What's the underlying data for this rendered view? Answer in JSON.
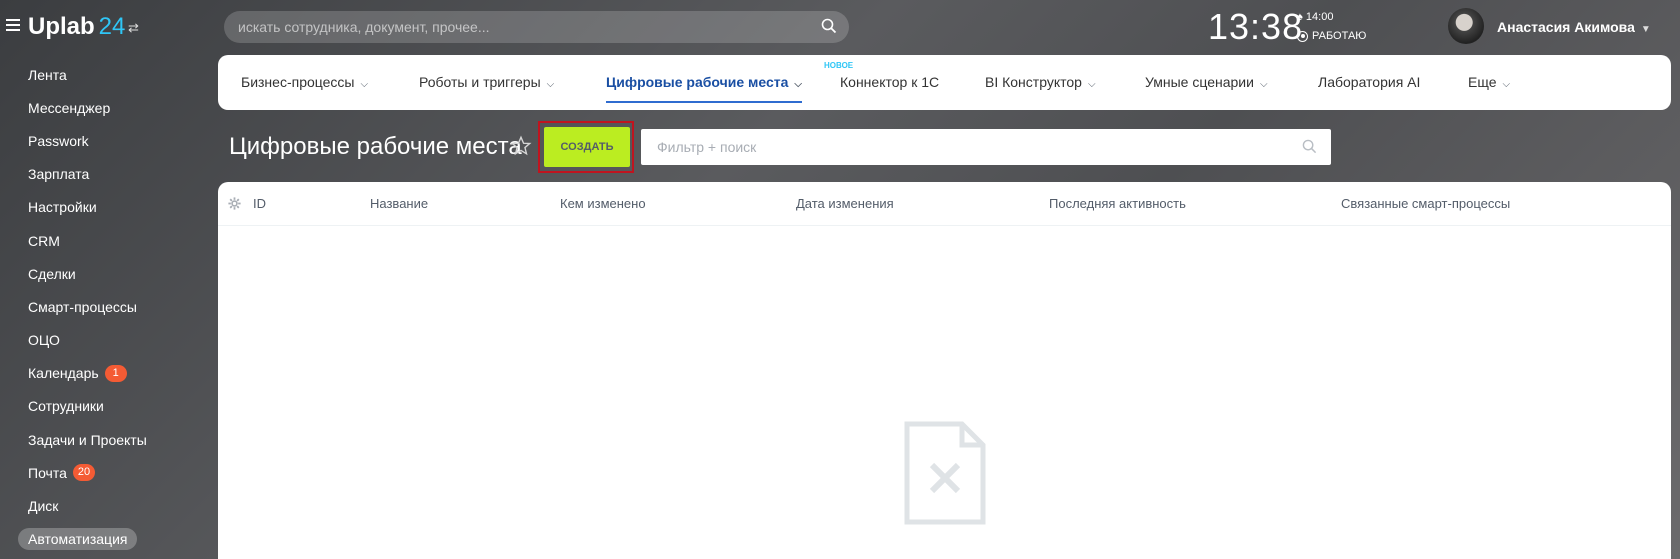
{
  "header": {
    "logo_text": "Uplab",
    "logo_num": "24",
    "search_placeholder": "искать сотрудника, документ, прочее...",
    "clock": "13:38",
    "alarm_time": "14:00",
    "work_status": "РАБОТАЮ",
    "user_name": "Анастасия Акимова",
    "accent_color": "#2fc6f6"
  },
  "sidebar": {
    "items": [
      {
        "label": "Лента"
      },
      {
        "label": "Мессенджер"
      },
      {
        "label": "Passwork"
      },
      {
        "label": "Зарплата"
      },
      {
        "label": "Настройки"
      },
      {
        "label": "CRM"
      },
      {
        "label": "Сделки"
      },
      {
        "label": "Смарт-процессы"
      },
      {
        "label": "ОЦО"
      },
      {
        "label": "Календарь",
        "badge": "1"
      },
      {
        "label": "Сотрудники"
      },
      {
        "label": "Задачи и Проекты"
      },
      {
        "label": "Почта",
        "badge": "20"
      },
      {
        "label": "Диск"
      },
      {
        "label": "Автоматизация",
        "active": true
      }
    ],
    "badge_color": "#f45b34"
  },
  "nav": {
    "new_tag": "НОВОЕ",
    "tabs": [
      {
        "label": "Бизнес-процессы"
      },
      {
        "label": "Роботы и триггеры"
      },
      {
        "label": "Цифровые рабочие места",
        "active": true
      },
      {
        "label": "Коннектор к 1С"
      },
      {
        "label": "BI Конструктор"
      },
      {
        "label": "Умные сценарии"
      },
      {
        "label": "Лаборатория AI"
      },
      {
        "label": "Еще"
      }
    ]
  },
  "page": {
    "title": "Цифровые рабочие места",
    "create_label": "СОЗДАТЬ",
    "create_color": "#bbed21",
    "filter_placeholder": "Фильтр + поиск"
  },
  "table": {
    "columns": [
      "ID",
      "Название",
      "Кем изменено",
      "Дата изменения",
      "Последняя активность",
      "Связанные смарт-процессы"
    ],
    "rows": []
  }
}
